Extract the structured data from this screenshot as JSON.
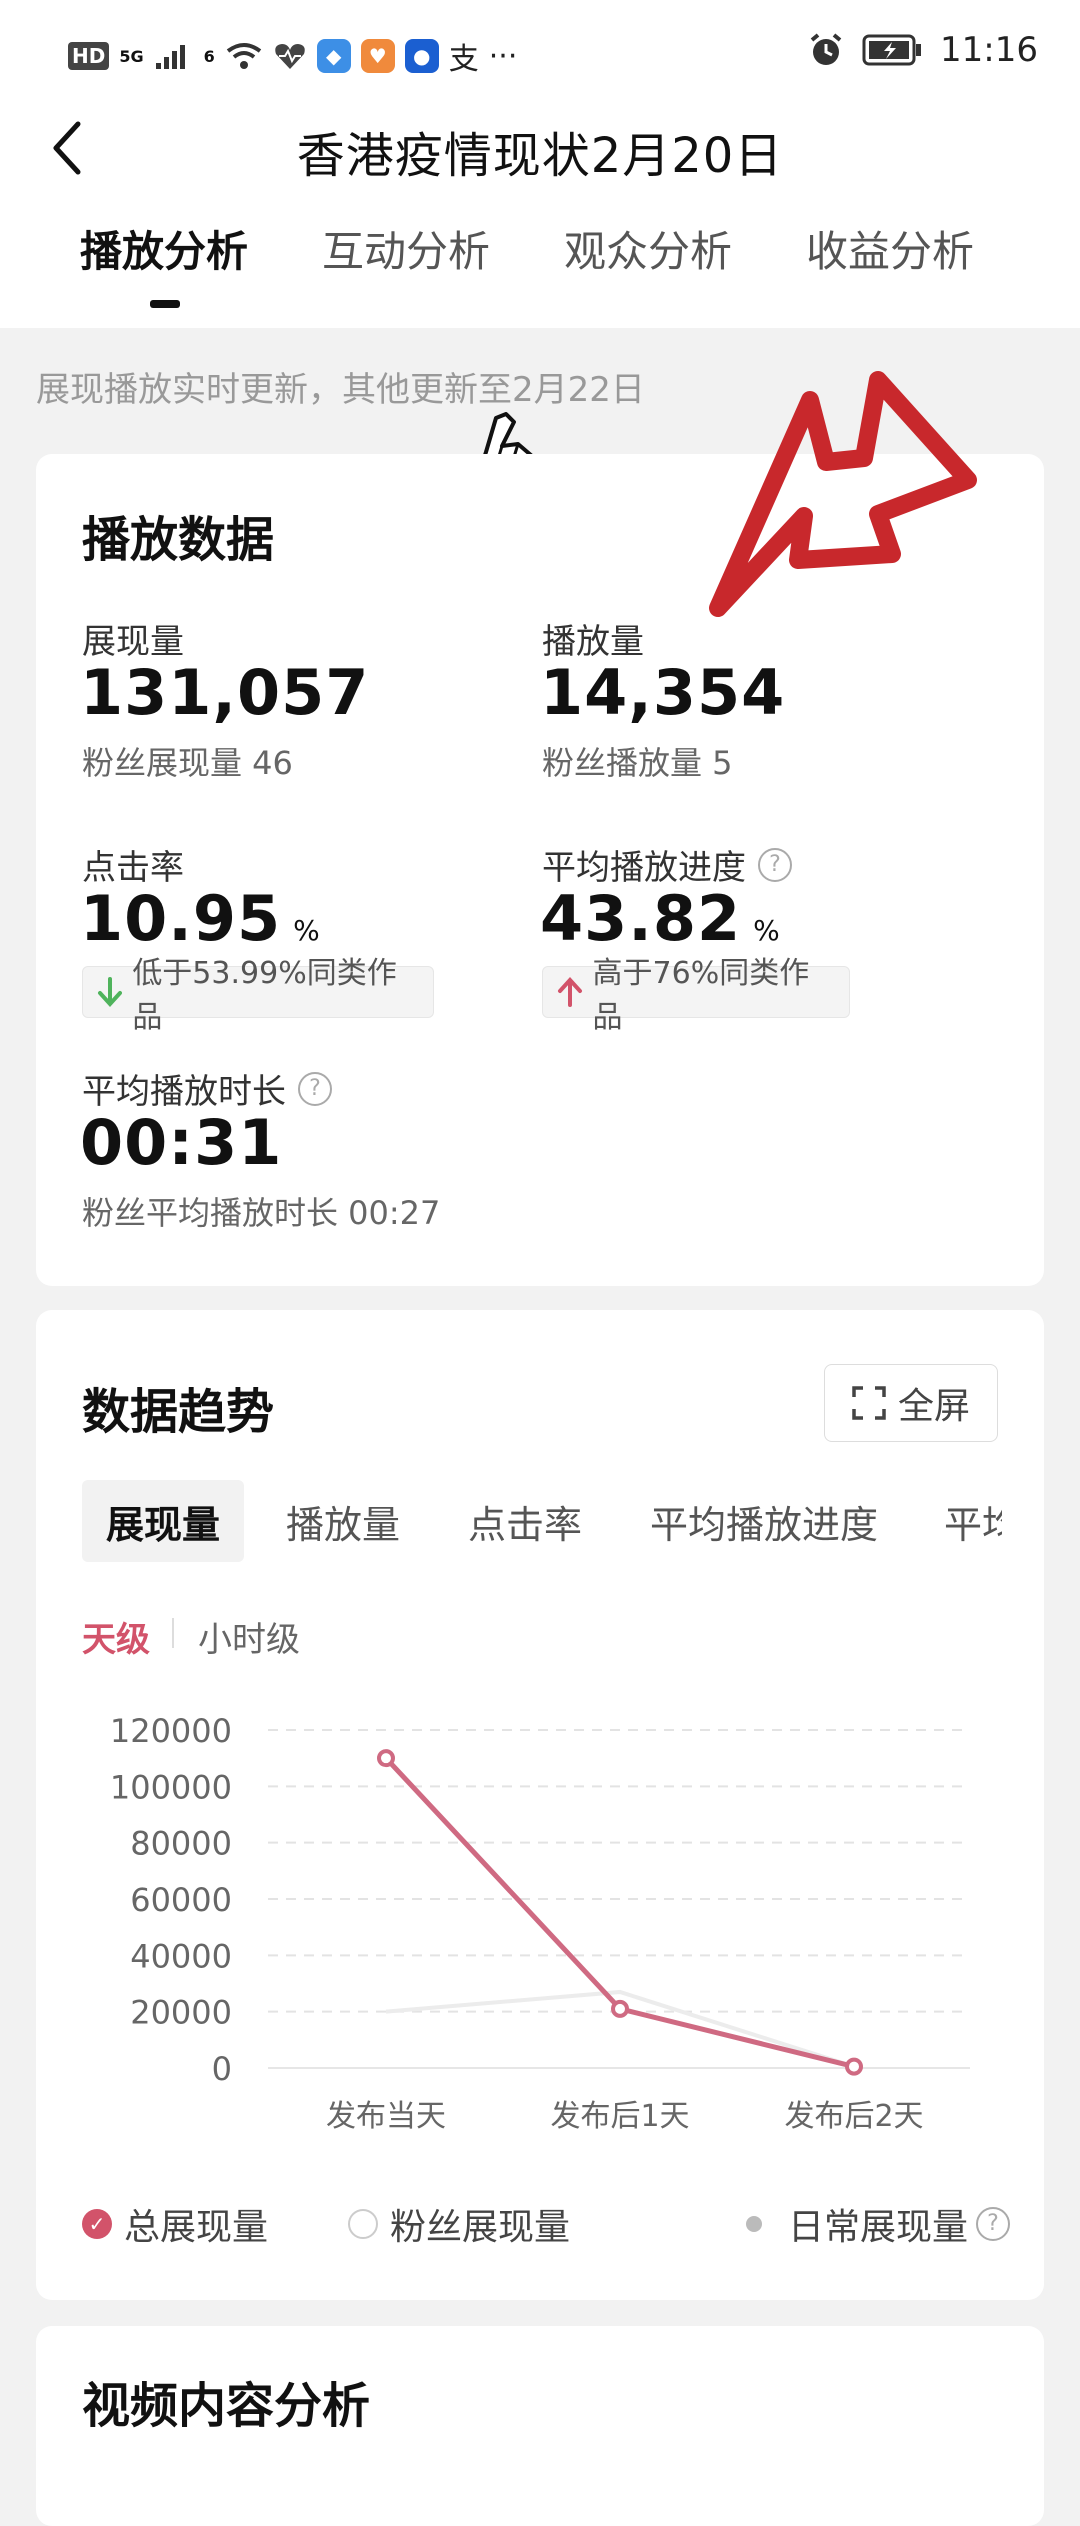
{
  "status_bar": {
    "badges": [
      "HD",
      "5G",
      "6"
    ],
    "time": "11:16",
    "extra_char": "支",
    "more": "···"
  },
  "header": {
    "title": "香港疫情现状2月20日",
    "tabs": [
      "播放分析",
      "互动分析",
      "观众分析",
      "收益分析"
    ],
    "active_tab": 0
  },
  "notice": "展现播放实时更新，其他更新至2月22日",
  "play_data": {
    "title": "播放数据",
    "impressions": {
      "label": "展现量",
      "value": "131,057",
      "sub": "粉丝展现量 46"
    },
    "plays": {
      "label": "播放量",
      "value": "14,354",
      "sub": "粉丝播放量 5"
    },
    "ctr": {
      "label": "点击率",
      "value": "10.95",
      "unit": "%",
      "compare": "低于53.99%同类作品",
      "direction": "down"
    },
    "progress": {
      "label": "平均播放进度",
      "value": "43.82",
      "unit": "%",
      "compare": "高于76%同类作品",
      "direction": "up"
    },
    "duration": {
      "label": "平均播放时长",
      "value": "00:31",
      "sub": "粉丝平均播放时长 00:27"
    }
  },
  "trend": {
    "title": "数据趋势",
    "fullscreen_label": "全屏",
    "metric_tabs": [
      "展现量",
      "播放量",
      "点击率",
      "平均播放进度",
      "平均播放时长"
    ],
    "active_metric": 0,
    "granularity": {
      "day": "天级",
      "hour": "小时级",
      "active": "day"
    },
    "legend": {
      "total": "总展现量",
      "fans": "粉丝展现量",
      "daily": "日常展现量"
    }
  },
  "chart_data": {
    "type": "line",
    "categories": [
      "发布当天",
      "发布后1天",
      "发布后2天"
    ],
    "series": [
      {
        "name": "总展现量",
        "values": [
          110000,
          21000,
          500
        ],
        "color": "#cf6a82"
      }
    ],
    "background_series": [
      20000,
      27000,
      500
    ],
    "yticks": [
      0,
      20000,
      40000,
      60000,
      80000,
      100000,
      120000
    ],
    "ylim": [
      0,
      120000
    ],
    "grid": true
  },
  "next_section": {
    "title": "视频内容分析"
  },
  "colors": {
    "accent": "#d2536a",
    "down": "#4fb35c",
    "up": "#d2536a",
    "arrow": "#c8282c"
  }
}
